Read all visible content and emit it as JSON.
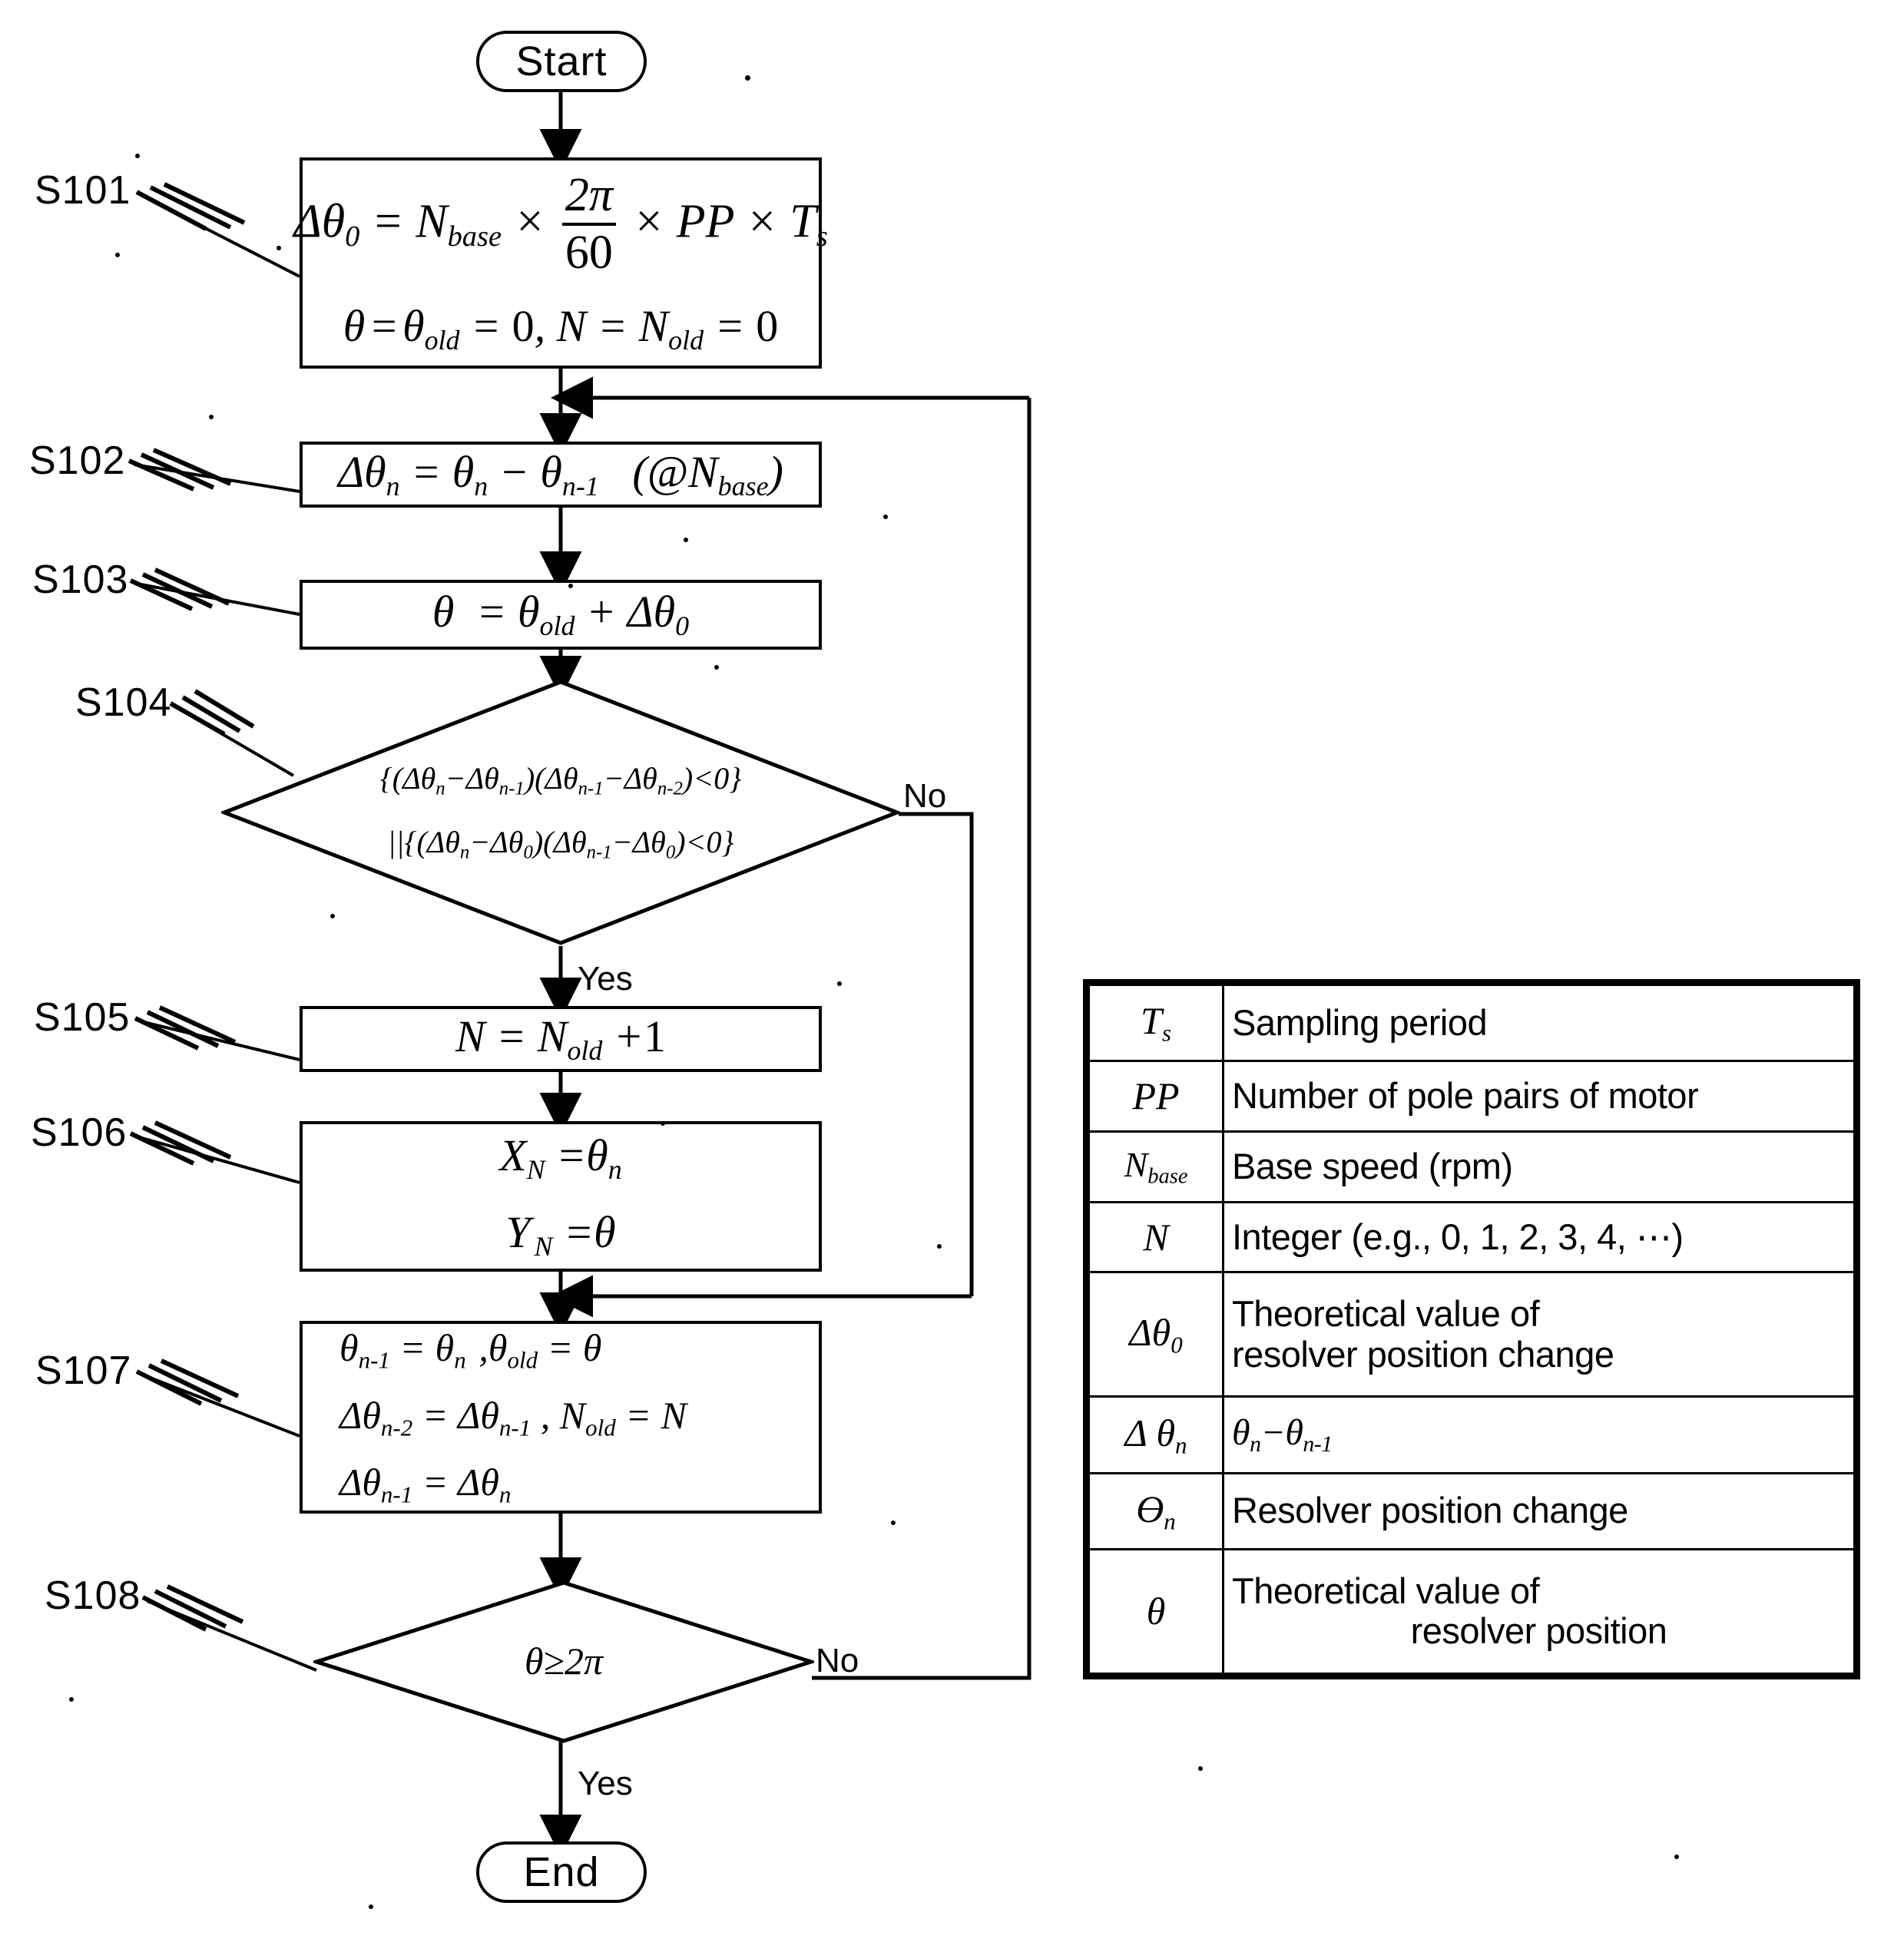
{
  "figure": {
    "type": "flowchart",
    "terminators": {
      "start": "Start",
      "end": "End"
    },
    "branch_labels": {
      "yes": "Yes",
      "no": "No"
    },
    "step_ids": [
      "S101",
      "S102",
      "S103",
      "S104",
      "S105",
      "S106",
      "S107",
      "S108"
    ],
    "steps": [
      {
        "id": "S101",
        "shape": "process",
        "lines": [
          "Δθ₀ = N_base × 2π/60 × PP × T_s",
          "θ = θ_old = 0, N = N_old = 0"
        ]
      },
      {
        "id": "S102",
        "shape": "process",
        "lines": [
          "Δθₙ = θₙ − θₙ₋₁   (@N_base)"
        ]
      },
      {
        "id": "S103",
        "shape": "process",
        "lines": [
          "θ = θ_old + Δθ₀"
        ]
      },
      {
        "id": "S104",
        "shape": "decision",
        "lines": [
          "{(Δθₙ−Δθₙ₋₁)(Δθₙ₋₁−Δθₙ₋₂)<0}",
          "||{(Δθₙ−Δθ₀)(Δθₙ₋₁−Δθ₀)<0}"
        ]
      },
      {
        "id": "S105",
        "shape": "process",
        "lines": [
          "N = N_old + 1"
        ]
      },
      {
        "id": "S106",
        "shape": "process",
        "lines": [
          "X_N = θₙ",
          "Y_N = θ"
        ]
      },
      {
        "id": "S107",
        "shape": "process",
        "lines": [
          "θₙ₋₁ = θₙ , θ_old = θ",
          "Δθₙ₋₂ = Δθₙ₋₁ , N_old = N",
          "Δθₙ₋₁ = Δθₙ"
        ]
      },
      {
        "id": "S108",
        "shape": "decision",
        "lines": [
          "θ ≥ 2π"
        ]
      }
    ]
  },
  "legend": {
    "columns": [
      "symbol",
      "description"
    ],
    "rows": [
      {
        "symbol": "T_s",
        "description": "Sampling period"
      },
      {
        "symbol": "PP",
        "description": "Number of pole pairs of motor"
      },
      {
        "symbol": "N_base",
        "description": "Base speed (rpm)"
      },
      {
        "symbol": "N",
        "description": "Integer (e.g., 0, 1, 2, 3, 4, ⋯)"
      },
      {
        "symbol": "Δθ₀",
        "description": "Theoretical value of resolver position change",
        "description_line1": "Theoretical value of",
        "description_line2": "resolver position change"
      },
      {
        "symbol": "Δ θₙ",
        "description": "θₙ−θₙ₋₁",
        "italic": true
      },
      {
        "symbol": "Θₙ",
        "description": "Resolver position change"
      },
      {
        "symbol": "θ",
        "description": "Theoretical value of resolver position",
        "description_line1": "Theoretical value of",
        "description_line2": "resolver position"
      }
    ]
  },
  "colors": {
    "ink": "#000000",
    "paper": "#ffffff"
  }
}
